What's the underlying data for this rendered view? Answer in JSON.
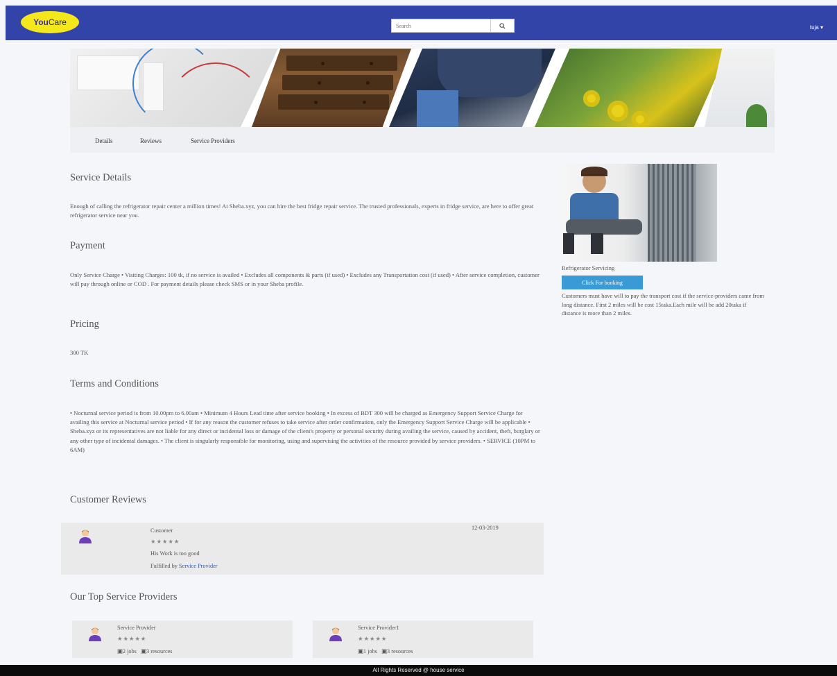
{
  "header": {
    "logo_you": "You",
    "logo_care": "Care",
    "search_placeholder": "Search",
    "user_label": "tuja ▾"
  },
  "tabs": [
    {
      "label": "Details"
    },
    {
      "label": "Reviews"
    },
    {
      "label": "Service Providers"
    }
  ],
  "service_details": {
    "heading": "Service Details",
    "text": "Enough of calling the refrigerator repair center a million times! At Sheba.xyz, you can hire the best fridge repair service. The trusted professionals, experts in fridge service, are here to offer great refrigerator service near you."
  },
  "payment": {
    "heading": "Payment",
    "text": "Only Service Charge • Visiting Charges: 100 tk, if no service is availed • Excludes all components & parts (if used) • Excludes any Transportation cost (if used) • After service completion, customer will pay through online or COD . For payment details please check SMS or in your Sheba profile."
  },
  "pricing": {
    "heading": "Pricing",
    "text": "300 TK"
  },
  "terms": {
    "heading": "Terms and Conditions",
    "text": "• Nocturnal service period is from 10.00pm to 6.00am • Minimum 4 Hours Lead time after service booking • In excess of BDT 300 will be charged as Emergency Support Service Charge for availing this service at Nocturnal service period • If for any reason the customer refuses to take service after order confirmation, only the Emergency Support Service Charge will be applicable • Sheba.xyz or its representatives are not liable for any direct or incidental loss or damage of the client's property or personal security during availing the service, caused by accident, theft, burglary or any other type of incidental damages. • The client is singularly responsible for monitoring, using and supervising the activities of the resource provided by service providers. • SERVICE (10PM to 6AM)"
  },
  "reviews": {
    "heading": "Customer Reviews",
    "items": [
      {
        "name": "Customer",
        "stars": "★★★★★",
        "comment": "His Work is too good",
        "fulfilled_prefix": "Fulfilled by",
        "fulfilled_link": "Service Provider",
        "date": "12-03-2019"
      }
    ]
  },
  "providers": {
    "heading": "Our Top Service Providers",
    "items": [
      {
        "name": "Service Provider",
        "stars": "★★★★★",
        "jobs": "2 jobs",
        "resources": "3 resources"
      },
      {
        "name": "Service Provider1",
        "stars": "★★★★★",
        "jobs": "1 jobs",
        "resources": "3 resources"
      }
    ]
  },
  "sidebar": {
    "caption": "Refrigerator Servicing",
    "book_label": "Click For booking",
    "note": "Customers must have will to pay the transport cost if the service-providers came from long distance. First 2 miles will be cost 15taka.Each mile will be add 20taka if distance is more than 2 miles."
  },
  "footer": {
    "text": "All Rights Reserved @ house service"
  },
  "colors": {
    "nav": "#3344a8",
    "logo": "#f4e81c",
    "button": "#3a9ad6",
    "link": "#2a5bb8",
    "footer": "#0b0b0b"
  }
}
